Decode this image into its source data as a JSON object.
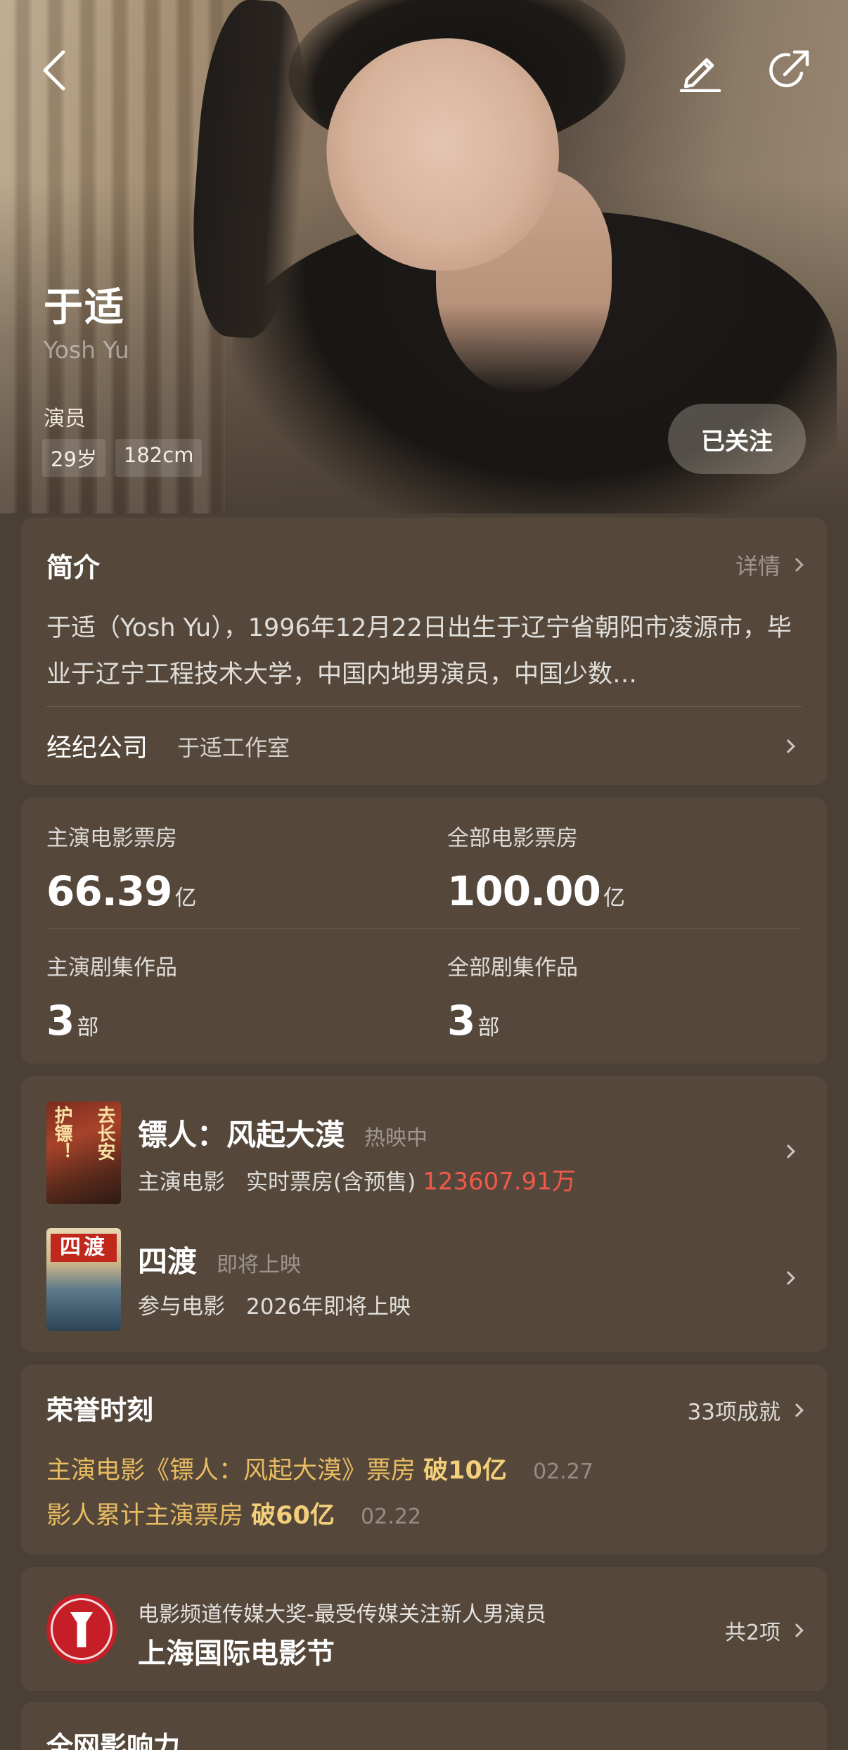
{
  "header": {
    "back_icon": "back-arrow-icon",
    "edit_icon": "edit-pencil-icon",
    "share_icon": "share-icon"
  },
  "profile": {
    "name": "于适",
    "english_name": "Yosh Yu",
    "role": "演员",
    "tags": [
      "29岁",
      "182cm"
    ],
    "follow_label": "已关注"
  },
  "intro": {
    "title": "简介",
    "detail_label": "详情",
    "bio": "于适（Yosh Yu），1996年12月22日出生于辽宁省朝阳市凌源市，毕业于辽宁工程技术大学，中国内地男演员，中国少数…",
    "agency_label": "经纪公司",
    "agency_value": "于适工作室"
  },
  "stats": [
    {
      "label": "主演电影票房",
      "value": "66.39",
      "unit": "亿"
    },
    {
      "label": "全部电影票房",
      "value": "100.00",
      "unit": "亿"
    },
    {
      "label": "主演剧集作品",
      "value": "3",
      "unit": "部"
    },
    {
      "label": "全部剧集作品",
      "value": "3",
      "unit": "部"
    }
  ],
  "works": [
    {
      "title": "镖人：风起大漠",
      "status": "热映中",
      "type": "主演电影",
      "info_label": "实时票房(含预售)",
      "box_office": "123607.91万",
      "poster_text_1": "护镖！",
      "poster_text_2": "去长安"
    },
    {
      "title": "四渡",
      "status": "即将上映",
      "type": "参与电影",
      "info_label": "2026年即将上映",
      "poster_text_1": "四渡"
    }
  ],
  "honors": {
    "title": "荣誉时刻",
    "count_label": "33项成就",
    "items": [
      {
        "text": "主演电影《镖人：风起大漠》票房",
        "highlight": "破10亿",
        "date": "02.27"
      },
      {
        "text": "影人累计主演票房",
        "highlight": "破60亿",
        "date": "02.22"
      }
    ]
  },
  "award": {
    "subtitle": "电影频道传媒大奖-最受传媒关注新人男演员",
    "title": "上海国际电影节",
    "count_label": "共2项"
  },
  "influence": {
    "title": "全网影响力"
  },
  "colors": {
    "background": "#4b4035",
    "card": "#55483b",
    "honor_gold": "#e9bb62",
    "box_office_red": "#f05a4a"
  }
}
